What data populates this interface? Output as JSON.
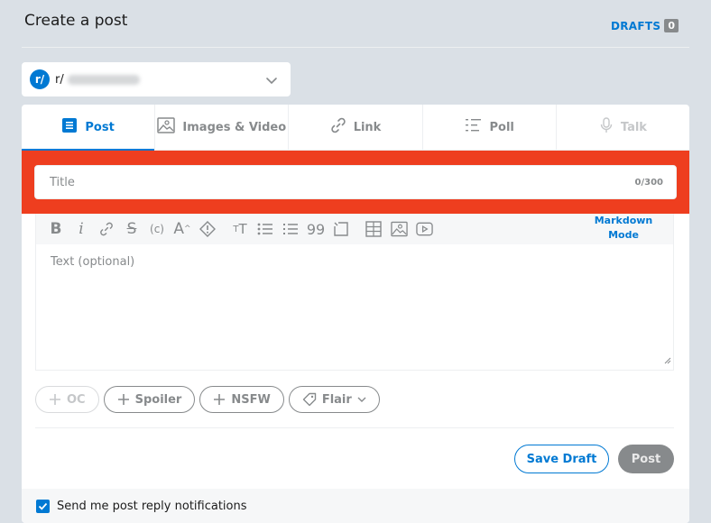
{
  "header": {
    "title": "Create a post",
    "drafts_label": "DRAFTS",
    "drafts_count": "0"
  },
  "community": {
    "avatar_glyph": "r/",
    "prefix": "r/",
    "name_blurred": true
  },
  "tabs": [
    {
      "label": "Post",
      "icon": "document-icon",
      "state": "active"
    },
    {
      "label": "Images & Video",
      "icon": "image-icon",
      "state": "normal"
    },
    {
      "label": "Link",
      "icon": "link-icon",
      "state": "normal"
    },
    {
      "label": "Poll",
      "icon": "poll-icon",
      "state": "normal"
    },
    {
      "label": "Talk",
      "icon": "microphone-icon",
      "state": "disabled"
    }
  ],
  "title_field": {
    "placeholder": "Title",
    "value": "",
    "counter": "0/300"
  },
  "toolbar": {
    "buttons": [
      "bold",
      "italic",
      "link",
      "strikethrough",
      "inline-code",
      "superscript",
      "spoiler",
      "heading",
      "bulleted-list",
      "numbered-list",
      "quote",
      "code-block",
      "table",
      "image",
      "video"
    ],
    "markdown_mode": "Markdown Mode"
  },
  "body_field": {
    "placeholder": "Text (optional)"
  },
  "pills": {
    "oc": "OC",
    "spoiler": "Spoiler",
    "nsfw": "NSFW",
    "flair": "Flair"
  },
  "actions": {
    "save_draft": "Save Draft",
    "post": "Post"
  },
  "footer": {
    "notify_label": "Send me post reply notifications",
    "notify_checked": true
  },
  "colors": {
    "accent": "#0079d3",
    "highlight": "#ee3e1f",
    "background": "#dae0e6",
    "muted": "#878a8c"
  }
}
